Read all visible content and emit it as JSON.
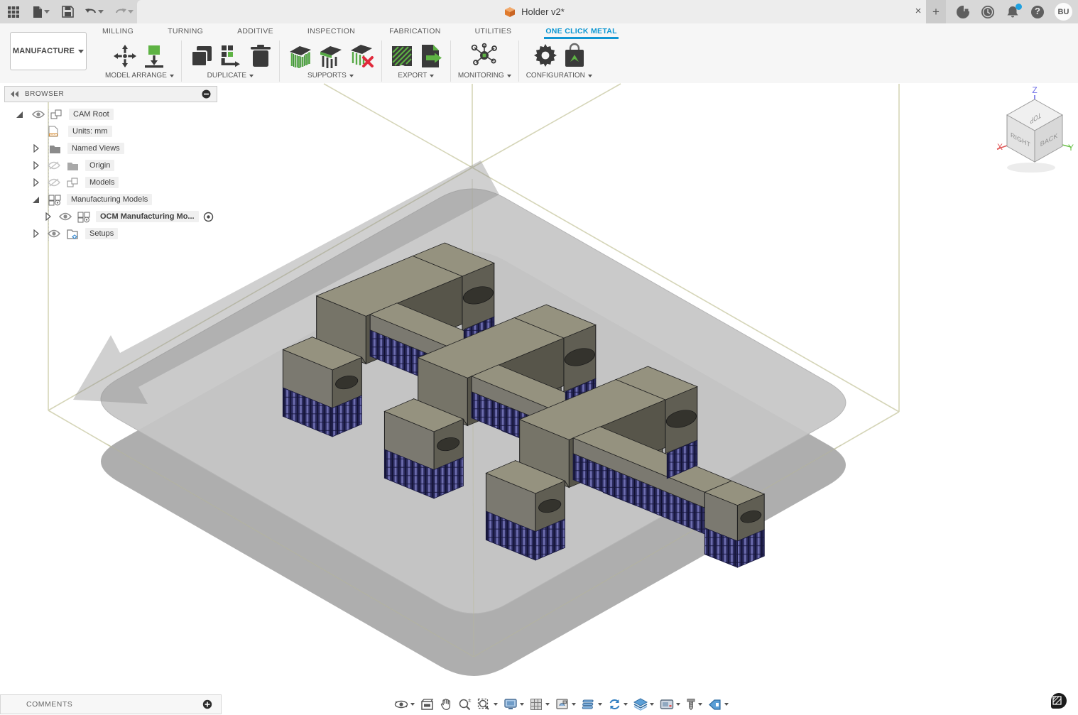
{
  "titlebar": {
    "doc_title": "Holder v2*",
    "close_glyph": "×",
    "newtab_glyph": "+",
    "help_glyph": "?",
    "user_initials": "BU"
  },
  "ribbon": {
    "workspace_label": "MANUFACTURE",
    "tabs": [
      {
        "label": "MILLING"
      },
      {
        "label": "TURNING"
      },
      {
        "label": "ADDITIVE"
      },
      {
        "label": "INSPECTION"
      },
      {
        "label": "FABRICATION"
      },
      {
        "label": "UTILITIES"
      },
      {
        "label": "ONE CLICK METAL"
      }
    ],
    "groups": [
      {
        "label": "MODEL ARRANGE"
      },
      {
        "label": "DUPLICATE"
      },
      {
        "label": "SUPPORTS"
      },
      {
        "label": "EXPORT"
      },
      {
        "label": "MONITORING"
      },
      {
        "label": "CONFIGURATION"
      }
    ]
  },
  "browser": {
    "header": "BROWSER",
    "items": [
      {
        "label": "CAM Root"
      },
      {
        "label": "Units: mm"
      },
      {
        "label": "Named Views"
      },
      {
        "label": "Origin"
      },
      {
        "label": "Models"
      },
      {
        "label": "Manufacturing Models"
      },
      {
        "label": "OCM Manufacturing Mo..."
      },
      {
        "label": "Setups"
      }
    ]
  },
  "viewcube": {
    "top": "TOP",
    "right": "RIGHT",
    "back": "BACK",
    "x": "X",
    "y": "Y",
    "z": "Z"
  },
  "comments": {
    "label": "COMMENTS"
  },
  "colors": {
    "accent_blue": "#0a96d2",
    "notification_blue": "#1fa1e0",
    "icon_green": "#5eb344",
    "delete_red": "#e02a3c",
    "support_blue": "#2b2b5e",
    "part_top": "#95927f",
    "plate_top": "#c6c6c6",
    "wireframe": "#d8d8bc",
    "doc_icon_orange": "#e8833a"
  }
}
